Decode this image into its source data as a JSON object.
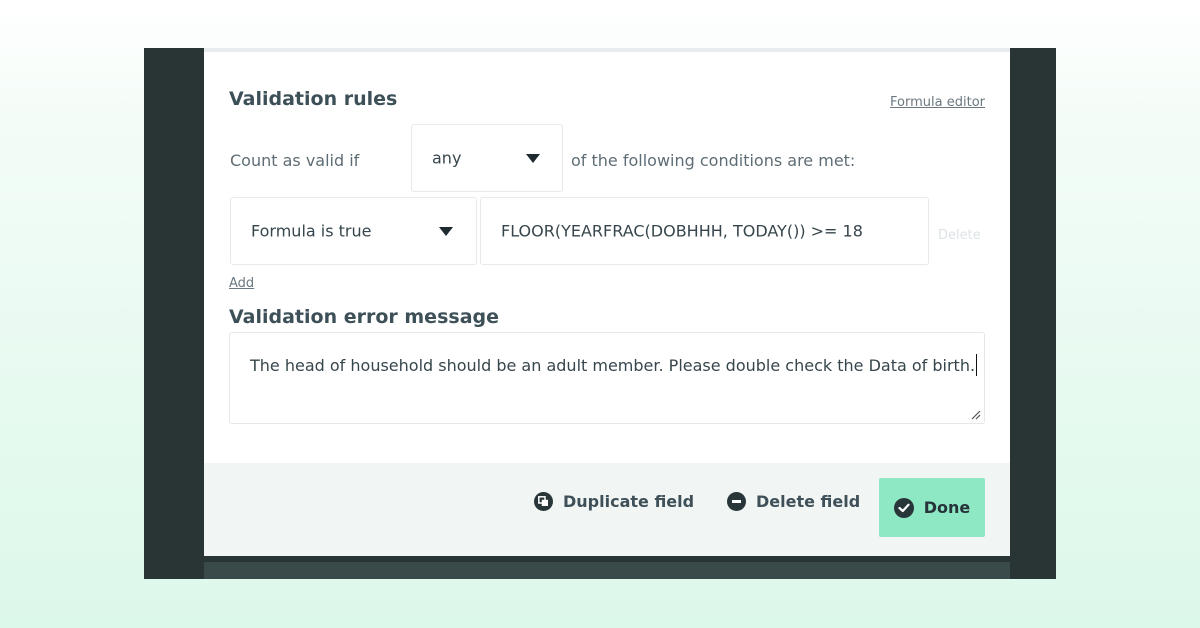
{
  "validation": {
    "title": "Validation rules",
    "formula_editor_link": "Formula editor",
    "count_label": "Count as valid if",
    "match_select": {
      "value": "any"
    },
    "conditions_text": "of the following conditions are met:",
    "condition": {
      "type_select": {
        "value": "Formula is true"
      },
      "formula_value": "FLOOR(YEARFRAC(DOBHHH, TODAY()) >= 18",
      "delete_label": "Delete"
    },
    "add_label": "Add"
  },
  "error_message": {
    "title": "Validation error message",
    "value": "The head of household should be an adult member. Please double check the Data of birth."
  },
  "footer": {
    "duplicate_label": "Duplicate field",
    "delete_label": "Delete field",
    "done_label": "Done"
  },
  "colors": {
    "frame": "#283534",
    "accent": "#8ee8c4",
    "footer_bg": "#f1f6f5"
  }
}
